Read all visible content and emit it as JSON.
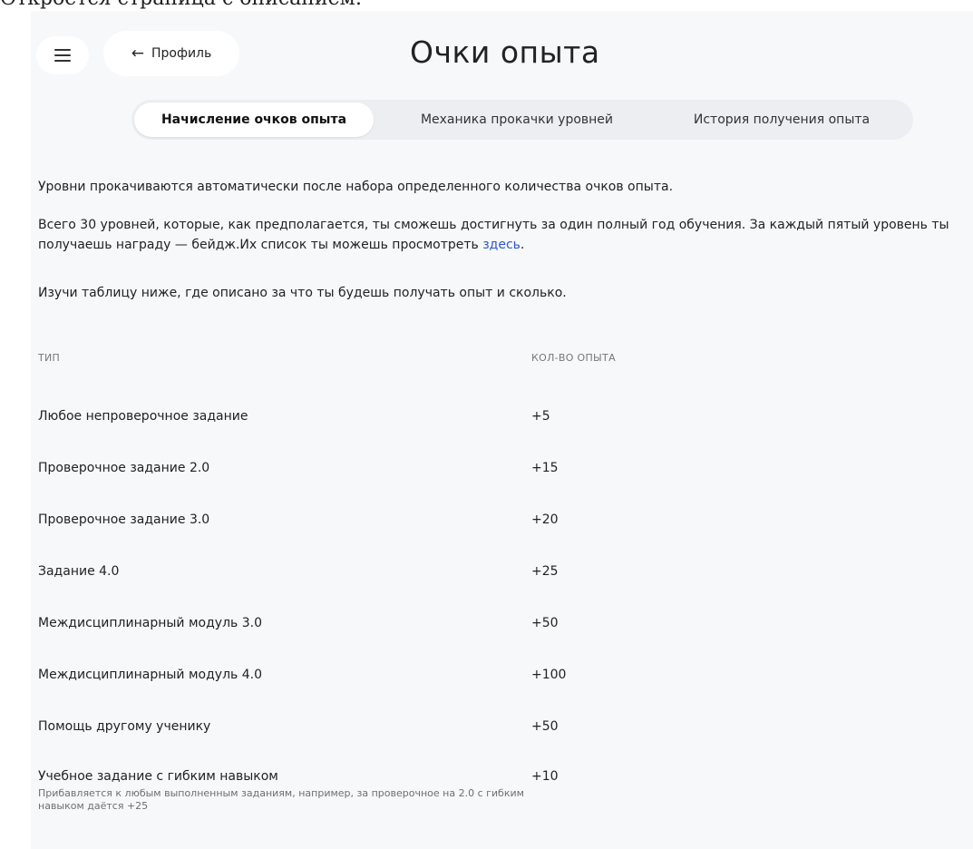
{
  "doc_caption": "Откроется страница с описанием:",
  "header": {
    "menu_icon": "hamburger-icon",
    "back_icon": "arrow-left-icon",
    "back_label": "Профиль",
    "title": "Очки опыта"
  },
  "tabs": [
    {
      "label": "Начисление очков опыта",
      "active": true
    },
    {
      "label": "Механика прокачки уровней",
      "active": false
    },
    {
      "label": "История получения опыта",
      "active": false
    }
  ],
  "intro": {
    "p1": "Уровни прокачиваются автоматически после набора определенного количества очков опыта.",
    "p2_text": "Всего 30 уровней, которые, как предполагается, ты сможешь достигнуть за один полный год обучения. За каждый пятый уровень ты получаешь награду — бейдж.Их список ты можешь просмотреть ",
    "p2_link": "здесь",
    "p2_end": ".",
    "p3": "Изучи таблицу ниже, где описано за что ты будешь получать опыт и сколько."
  },
  "table": {
    "headers": {
      "type": "ТИП",
      "amount": "КОЛ-ВО ОПЫТА"
    },
    "rows": [
      {
        "type": "Любое непроверочное задание",
        "amount": "+5"
      },
      {
        "type": "Проверочное задание 2.0",
        "amount": "+15"
      },
      {
        "type": "Проверочное задание 3.0",
        "amount": "+20"
      },
      {
        "type": "Задание 4.0",
        "amount": "+25"
      },
      {
        "type": "Междисциплинарный модуль 3.0",
        "amount": "+50"
      },
      {
        "type": "Междисциплинарный модуль 4.0",
        "amount": "+100"
      },
      {
        "type": "Помощь другому ученику",
        "amount": "+50"
      },
      {
        "type": "Учебное задание с гибким навыком",
        "amount": "+10"
      }
    ],
    "note": "Прибавляется к любым выполненным заданиям, например, за проверочное на 2.0 с гибким навыком даётся +25"
  },
  "colors": {
    "panel_bg": "#f7f8fa",
    "tab_bar_bg": "#eceef2",
    "link": "#2c58c8"
  }
}
